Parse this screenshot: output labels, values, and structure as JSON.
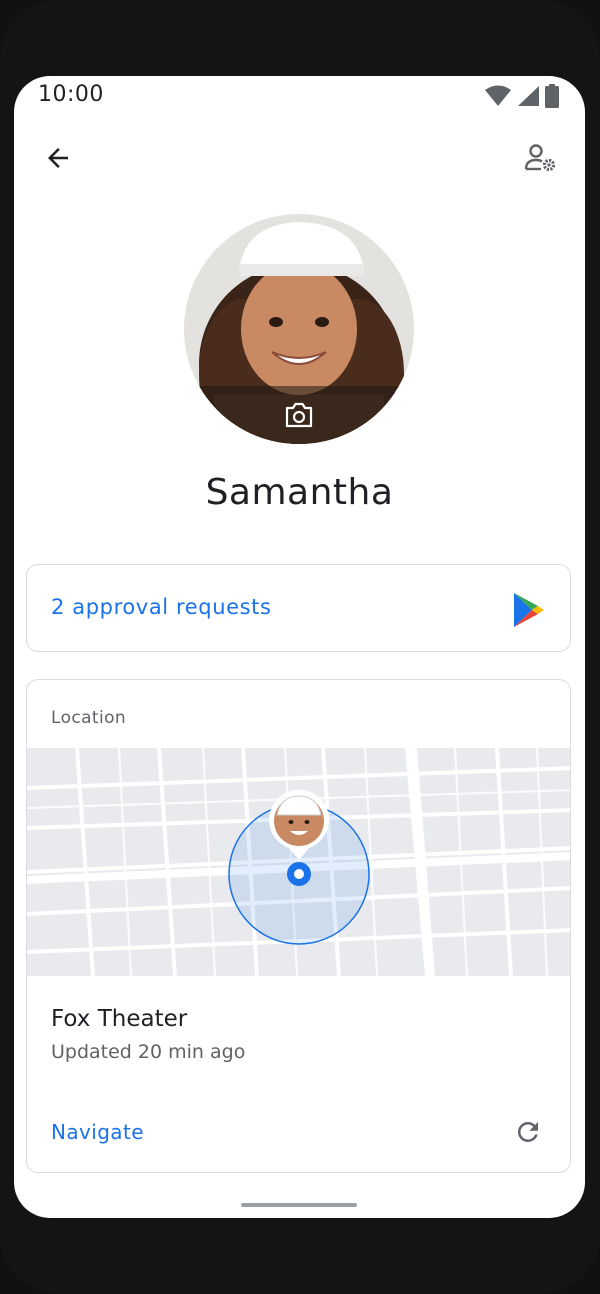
{
  "status_bar": {
    "time": "10:00",
    "icons": [
      "wifi-icon",
      "cellular-signal-icon",
      "battery-icon"
    ]
  },
  "app_bar": {
    "back_icon": "arrow-back-icon",
    "settings_icon": "person-settings-icon"
  },
  "profile": {
    "name": "Samantha",
    "photo_icon": "camera-icon"
  },
  "approvals": {
    "label": "2 approval requests",
    "icon": "google-play-icon"
  },
  "location": {
    "label": "Location",
    "place": "Fox Theater",
    "updated": "Updated 20 min ago",
    "navigate_label": "Navigate",
    "refresh_icon": "refresh-icon"
  },
  "colors": {
    "accent": "#1a73e8",
    "text_primary": "#202124",
    "text_secondary": "#5f6368",
    "card_border": "#dadce0",
    "map_background": "#e8eaed"
  }
}
